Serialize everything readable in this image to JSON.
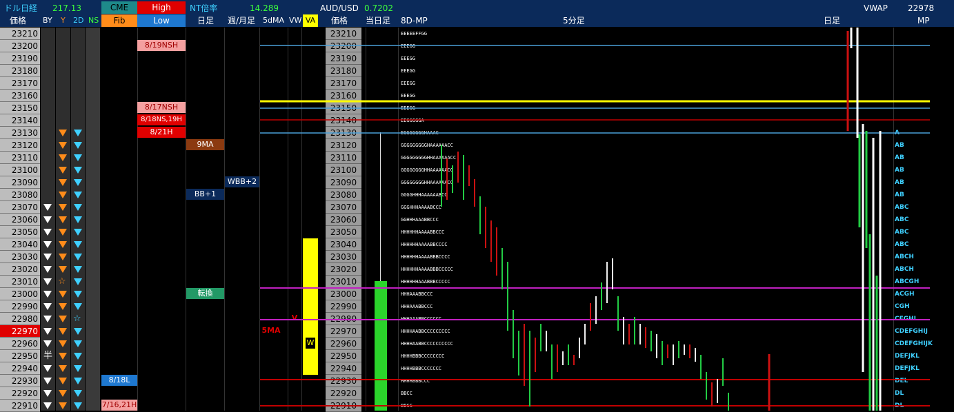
{
  "header": {
    "dollar_nikkei_label": "ドル日経",
    "dollar_nikkei_value": "217.13",
    "cme_label": "CME",
    "high_label": "High",
    "nt_label": "NT倍率",
    "nt_value": "14.289",
    "audusd_label": "AUD/USD",
    "audusd_value": "0.7202",
    "vwap_label": "VWAP",
    "vwap_value": "22978",
    "fib_label": "Fib",
    "low_label": "Low"
  },
  "columns": {
    "price": "価格",
    "by": "BY",
    "y": "Y",
    "two_d": "2D",
    "ns": "NS",
    "daily": "日足",
    "weekly_monthly": "週/月足",
    "fivedma": "5dMA",
    "vw": "VW",
    "va": "VA",
    "price2": "価格",
    "today": "当日足",
    "mp8d": "8D-MP",
    "five_min": "5分足",
    "daily2": "日足",
    "mp": "MP"
  },
  "prices": [
    "23210",
    "23200",
    "23190",
    "23180",
    "23170",
    "23160",
    "23150",
    "23140",
    "23130",
    "23120",
    "23110",
    "23100",
    "23090",
    "23080",
    "23070",
    "23060",
    "23050",
    "23040",
    "23030",
    "23020",
    "23010",
    "23000",
    "22990",
    "22980",
    "22970",
    "22960",
    "22950",
    "22940",
    "22930",
    "22920",
    "22910"
  ],
  "current_price": "22970",
  "badges": {
    "nsh_819": "8/19NSH",
    "nsh_817": "8/17NSH",
    "ns_818": "8/18NS,19H",
    "h_821": "8/21H",
    "l_818": "8/18L",
    "l_716": "7/16,21H",
    "ma9": "9MA",
    "wbb2": "WBB+2",
    "bb1": "BB+1",
    "tenkan": "転換",
    "ma5": "5MA",
    "vw_v": "V",
    "va_w": "W",
    "star": "☆",
    "half": "半"
  },
  "tpo": [
    "EEEEEFFGG",
    "EEEGG",
    "EEEGG",
    "EEEGG",
    "EEEGG",
    "EEEGG",
    "EEEGG",
    "EEGGGGGA",
    "EGGGGGGGHAAAC",
    "GGGGGGGGGHAAAAAACC",
    "GGGGGGGGGHHAAAAAACC",
    "GGGGGGGGHHAAAAAACC",
    "GGGGGGGGHHAAAAAACC",
    "GGGGHHHAAAAAABCC",
    "GGGHHHAAAABCCC",
    "GGHHHAAABBCCC",
    "HHHHHHAAAABBCCC",
    "HHHHHHAAAABBCCCC",
    "HHHHHHAAAABBBCCCC",
    "HHHHHHAAAABBBCCCCC",
    "HHHHHHAAABBBCCCCC",
    "HHHAAABBCCC",
    "HHHAAABBCCC",
    "HHHAAABBCCCCCC",
    "HHHHAABBCCCCCCCCC",
    "HHHHAABBCCCCCCCCCC",
    "HHHHBBBCCCCCCCC",
    "HHHHBBBCCCCCCC",
    "HHHHBBBCCC",
    "BBCC",
    "BBCC"
  ],
  "mp": [
    "",
    "",
    "",
    "",
    "",
    "",
    "",
    "",
    "A",
    "AB",
    "AB",
    "AB",
    "AB",
    "AB",
    "ABC",
    "ABC",
    "ABC",
    "ABC",
    "ABCH",
    "ABCH",
    "ABCGH",
    "ACGH",
    "CGH",
    "CFGHI",
    "CDEFGHIJ",
    "CDEFGHIJK",
    "DEFJKL",
    "DEFJKL",
    "DEL",
    "DL",
    "DL"
  ],
  "colors": {
    "header_bg": "#0b2a5a",
    "yellow_line": "#ffff00",
    "blue_line": "#4aa0d8",
    "red_line": "#c00000",
    "magenta_line": "#c020c0",
    "green_bar": "#2bd42b",
    "red_candle": "#cc1111",
    "green_candle": "#22cc44"
  }
}
